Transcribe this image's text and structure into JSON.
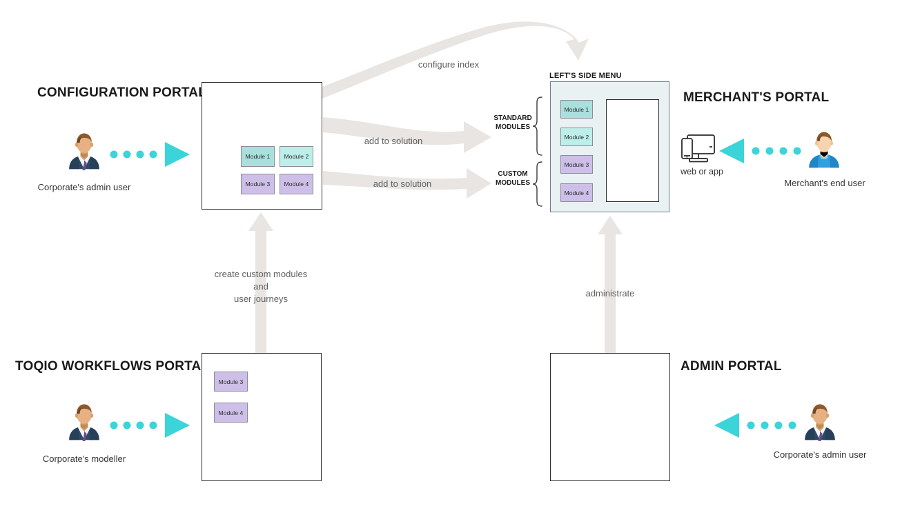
{
  "colors": {
    "accent_teal": "#3ad4d9",
    "arrow_gray": "#e8e5e2",
    "module_standard_a": "#a9e0dd",
    "module_standard_b": "#bdeeea",
    "module_custom": "#cdbfe8",
    "frame_border": "#2b2b2b",
    "panel_tint": "#eaf1f3",
    "label_gray": "#5f5f5f"
  },
  "portals": {
    "configuration": {
      "title": "CONFIGURATION PORTAL",
      "icon": "list-icon",
      "modules": [
        "Module 1",
        "Module 2",
        "Module 3",
        "Module 4"
      ]
    },
    "merchant": {
      "title": "MERCHANT'S PORTAL",
      "side_menu_label": "LEFT'S SIDE MENU",
      "modules": [
        "Module 1",
        "Module 2",
        "Module 3",
        "Module 4"
      ]
    },
    "toqio": {
      "title": "TOQIO WORKFLOWS PORTAL",
      "modules": [
        "Module 3",
        "Module 4"
      ]
    },
    "admin": {
      "title": "ADMIN PORTAL"
    }
  },
  "brackets": {
    "standard": "STANDARD\nMODULES",
    "standard_line1": "STANDARD",
    "standard_line2": "MODULES",
    "custom_line1": "CUSTOM",
    "custom_line2": "MODULES"
  },
  "flows": {
    "configure_index": "configure index",
    "add_to_solution_standard": "add to solution",
    "add_to_solution_custom": "add to solution",
    "create_modules_line1": "create custom modules",
    "create_modules_line2": "and",
    "create_modules_line3": "user journeys",
    "administrate": "administrate"
  },
  "actors": {
    "corporate_admin_top": {
      "label": "Corporate's admin user",
      "icon": "businessman-avatar-icon",
      "direction": "right"
    },
    "corporate_modeller": {
      "label": "Corporate's modeller",
      "icon": "businessman-avatar-icon",
      "direction": "right"
    },
    "merchant_end_user": {
      "label": "Merchant's end user",
      "icon": "casual-user-avatar-icon",
      "direction": "left"
    },
    "corporate_admin_bottom": {
      "label": "Corporate's admin user",
      "icon": "businessman-avatar-icon",
      "direction": "left"
    },
    "device": {
      "label": "web or app",
      "icon": "monitor-and-phone-icon"
    }
  }
}
